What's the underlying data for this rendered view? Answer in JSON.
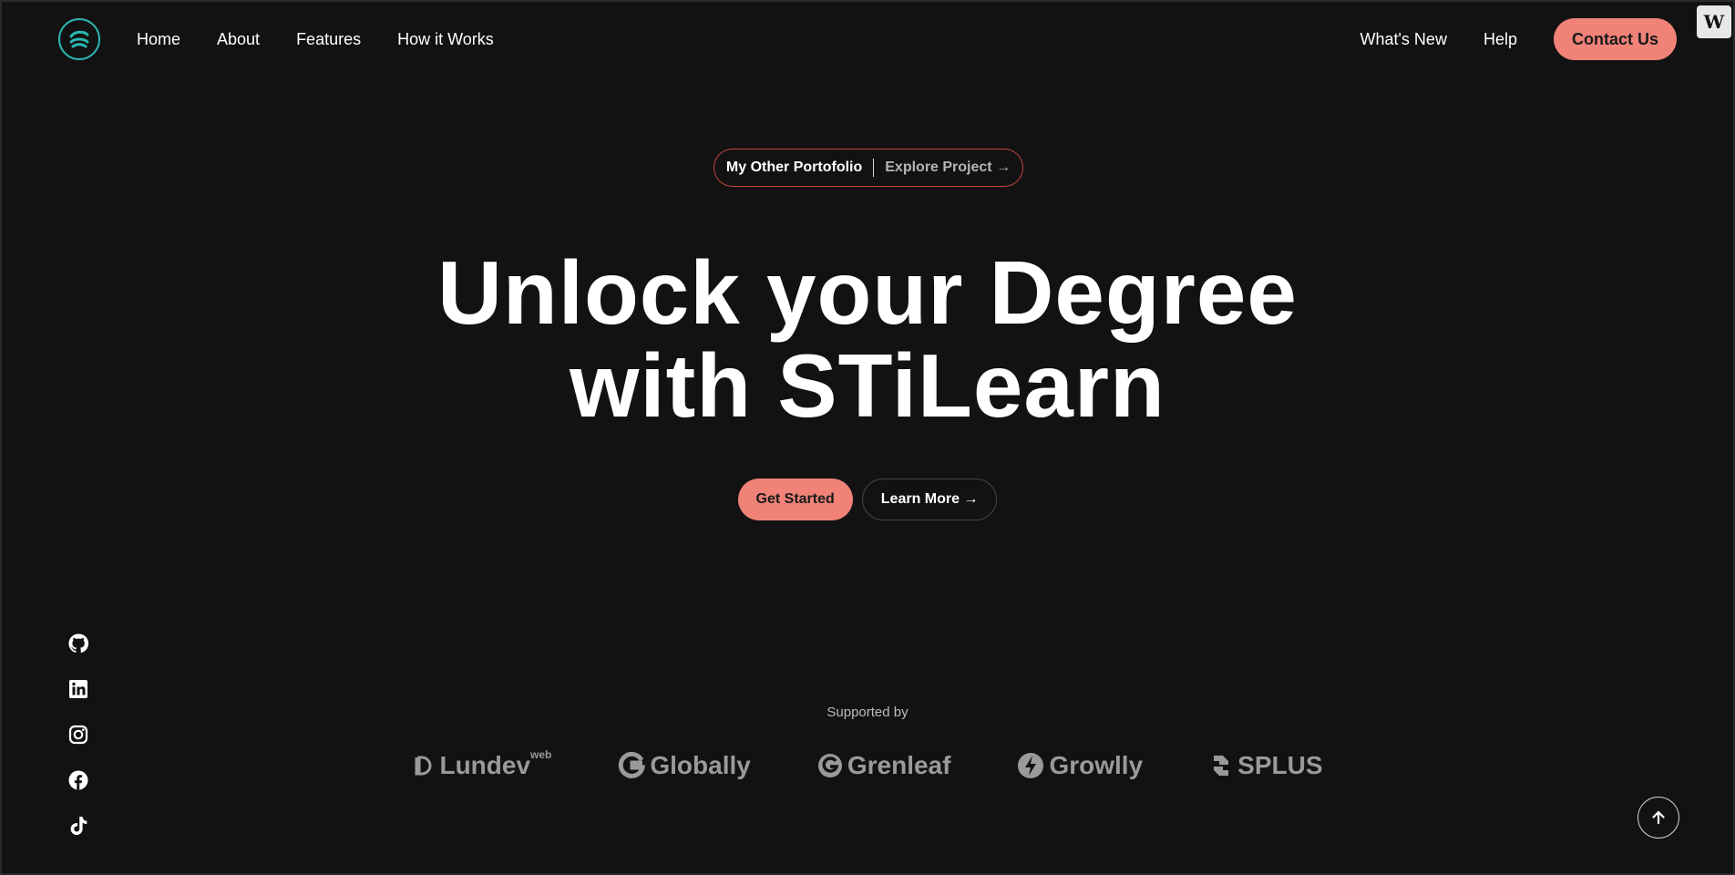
{
  "nav": {
    "logo_icon": "logo-icon",
    "left_links": [
      {
        "label": "Home"
      },
      {
        "label": "About"
      },
      {
        "label": "Features"
      },
      {
        "label": "How it Works"
      }
    ],
    "right_links": [
      {
        "label": "What's New"
      },
      {
        "label": "Help"
      }
    ],
    "contact_label": "Contact Us"
  },
  "corner_badge": "W",
  "pill": {
    "label": "My Other Portofolio",
    "link": "Explore Project →"
  },
  "hero": {
    "line1": "Unlock your Degree",
    "line2": "with STiLearn"
  },
  "cta": {
    "primary": "Get Started",
    "secondary": "Learn More →"
  },
  "socials": [
    "github-icon",
    "linkedin-icon",
    "instagram-icon",
    "facebook-icon",
    "tiktok-icon"
  ],
  "supported_by": {
    "label": "Supported by",
    "brands": [
      {
        "name": "Lundev",
        "sup": "web"
      },
      {
        "name": "Globally"
      },
      {
        "name": "Grenleaf"
      },
      {
        "name": "Growlly"
      },
      {
        "name": "SPLUS"
      }
    ]
  },
  "colors": {
    "accent": "#f08278",
    "background": "#121212",
    "logo_ring": "#2bb7b0",
    "pill_border": "#c0433e"
  }
}
